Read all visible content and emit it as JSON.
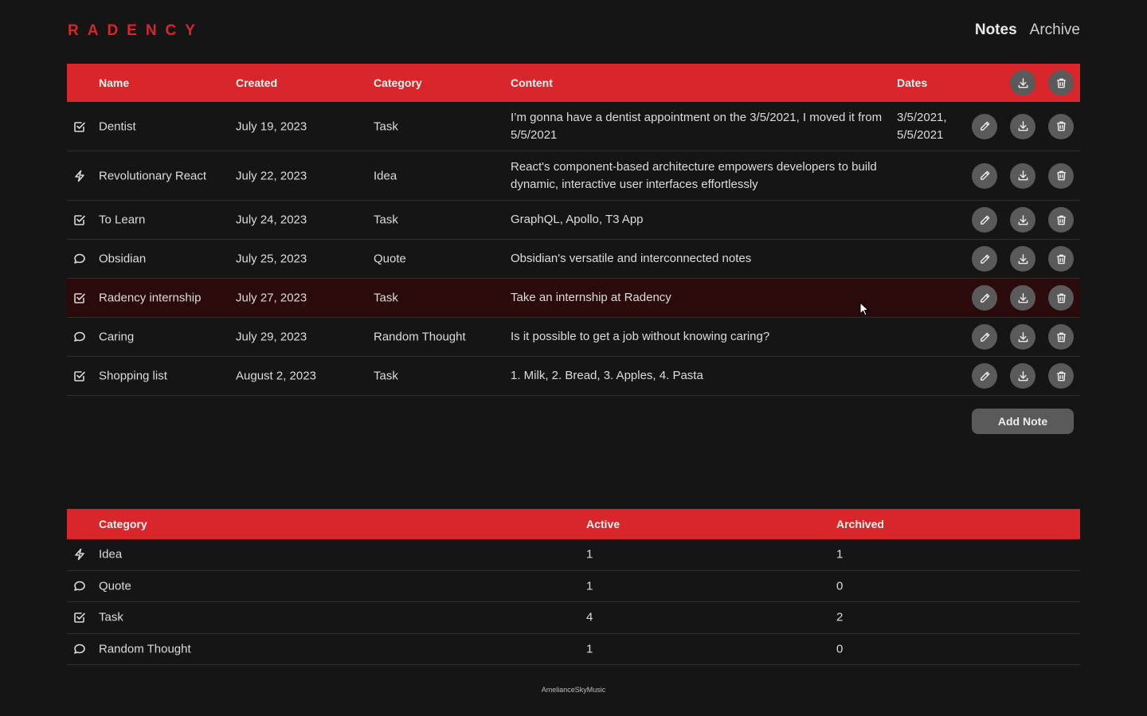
{
  "brand": {
    "logo": "RADENCY",
    "accent": "#d9262a"
  },
  "nav": {
    "notes": "Notes",
    "archive": "Archive"
  },
  "notes_table": {
    "headers": {
      "name": "Name",
      "created": "Created",
      "category": "Category",
      "content": "Content",
      "dates": "Dates"
    },
    "rows": [
      {
        "icon": "task-check-icon",
        "name": "Dentist",
        "created": "July 19, 2023",
        "category": "Task",
        "content": "I’m gonna have a dentist appointment on the 3/5/2021, I moved it from 5/5/2021",
        "dates": "3/5/2021, 5/5/2021"
      },
      {
        "icon": "idea-bolt-icon",
        "name": "Revolutionary React",
        "created": "July 22, 2023",
        "category": "Idea",
        "content": "React's component-based architecture empowers developers to build dynamic, interactive user interfaces effortlessly",
        "dates": ""
      },
      {
        "icon": "task-check-icon",
        "name": "To Learn",
        "created": "July 24, 2023",
        "category": "Task",
        "content": "GraphQL, Apollo, T3 App",
        "dates": ""
      },
      {
        "icon": "quote-bubble-icon",
        "name": "Obsidian",
        "created": "July 25, 2023",
        "category": "Quote",
        "content": "Obsidian's versatile and interconnected notes",
        "dates": ""
      },
      {
        "icon": "task-check-icon",
        "name": "Radency internship",
        "created": "July 27, 2023",
        "category": "Task",
        "content": "Take an internship at Radency",
        "dates": ""
      },
      {
        "icon": "quote-bubble-icon",
        "name": "Caring",
        "created": "July 29, 2023",
        "category": "Random Thought",
        "content": "Is it possible to get a job without knowing caring?",
        "dates": ""
      },
      {
        "icon": "task-check-icon",
        "name": "Shopping list",
        "created": "August 2, 2023",
        "category": "Task",
        "content": "1. Milk, 2. Bread, 3. Apples, 4. Pasta",
        "dates": ""
      }
    ]
  },
  "add_note": "Add Note",
  "summary_table": {
    "headers": {
      "category": "Category",
      "active": "Active",
      "archived": "Archived"
    },
    "rows": [
      {
        "icon": "idea-bolt-icon",
        "category": "Idea",
        "active": "1",
        "archived": "1"
      },
      {
        "icon": "quote-bubble-icon",
        "category": "Quote",
        "active": "1",
        "archived": "0"
      },
      {
        "icon": "task-check-icon",
        "category": "Task",
        "active": "4",
        "archived": "2"
      },
      {
        "icon": "quote-bubble-icon",
        "category": "Random Thought",
        "active": "1",
        "archived": "0"
      }
    ]
  },
  "footer": "AmelianceSkyMusic"
}
